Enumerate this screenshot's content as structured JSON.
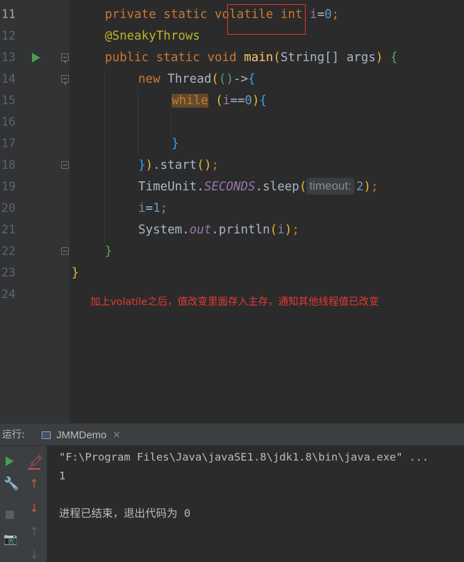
{
  "editor": {
    "line_numbers": [
      "11",
      "12",
      "13",
      "14",
      "15",
      "16",
      "17",
      "18",
      "19",
      "20",
      "21",
      "22",
      "23",
      "24"
    ],
    "active_line": "11",
    "code": {
      "l11": {
        "kw1": "private static ",
        "kw_volatile": "volatile",
        "kw2": " int ",
        "var": "i",
        "eq": "=",
        "num": "0",
        "semi": ";"
      },
      "l12": {
        "ann": "@SneakyThrows"
      },
      "l13": {
        "kw": "public static void ",
        "fn": "main",
        "p_open": "(",
        "type": "String[] args",
        "p_close": ")",
        "space": " ",
        "brace": "{"
      },
      "l14": {
        "kw": "new ",
        "cls": "Thread",
        "p_open": "(",
        "lambda_open": "(",
        "lambda_close": ")",
        "arrow": "->",
        "brace": "{"
      },
      "l15": {
        "kw": "while",
        "space": " ",
        "p_open": "(",
        "var": "i",
        "eq": "==",
        "num": "0",
        "p_close": ")",
        "brace": "{"
      },
      "l17": {
        "brace": "}"
      },
      "l18": {
        "brace": "}",
        "p_close": ")",
        "call": ".start",
        "args": "()",
        "semi": ";"
      },
      "l19": {
        "cls": "TimeUnit.",
        "stat": "SECONDS",
        "call": ".sleep",
        "p_open": "(",
        "hint": "timeout:",
        "num": "2",
        "p_close": ")",
        "semi": ";"
      },
      "l20": {
        "var": "i",
        "eq": "=",
        "num": "1",
        "semi": ";"
      },
      "l21": {
        "cls": "System.",
        "stat": "out",
        "call": ".println",
        "p_open": "(",
        "var": "i",
        "p_close": ")",
        "semi": ";"
      },
      "l22": {
        "brace": "}"
      },
      "l23": {
        "brace": "}"
      }
    },
    "annotation_note": "加上volatile之后，值改变里面存入主存，通知其他线程值已改变",
    "highlight_color": "#e53935"
  },
  "run_panel": {
    "title": "运行:",
    "tab_label": "JMMDemo",
    "tab_close": "×",
    "command_line": "\"F:\\Program Files\\Java\\javaSE1.8\\jdk1.8\\bin\\java.exe\" ...",
    "output_value": "1",
    "exit_message": "进程已结束，退出代码为 0"
  },
  "icons": {
    "gutter_run": "run-arrow-icon",
    "wrench": "🔧",
    "camera": "📷",
    "up": "↑",
    "down": "↓",
    "scroll_end": "🖍"
  }
}
